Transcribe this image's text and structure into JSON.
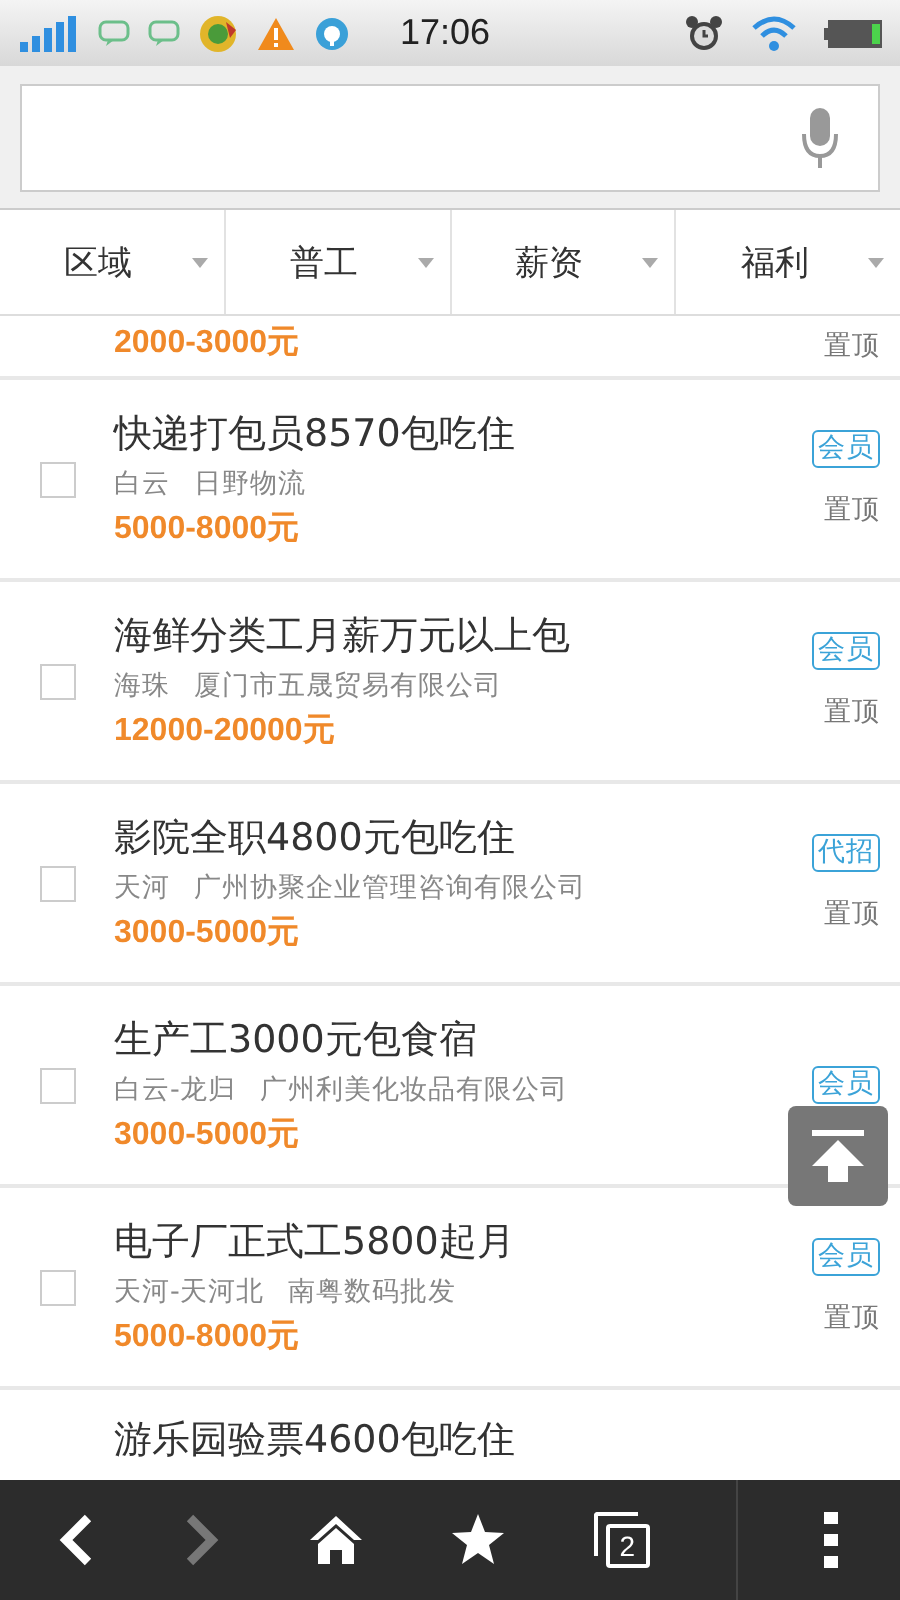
{
  "status_bar": {
    "time": "17:06"
  },
  "filters": [
    {
      "label": "区域"
    },
    {
      "label": "普工"
    },
    {
      "label": "薪资"
    },
    {
      "label": "福利"
    }
  ],
  "jobs": [
    {
      "salary": "2000-3000元",
      "pin": "置顶"
    },
    {
      "title": "快递打包员8570包吃住",
      "area": "白云",
      "company": "日野物流",
      "salary": "5000-8000元",
      "badge": "会员",
      "pin": "置顶",
      "checked": false
    },
    {
      "title": "海鲜分类工月薪万元以上包",
      "area": "海珠",
      "company": "厦门市五晟贸易有限公司",
      "salary": "12000-20000元",
      "badge": "会员",
      "pin": "置顶",
      "checked": false
    },
    {
      "title": "影院全职4800元包吃住",
      "area": "天河",
      "company": "广州协聚企业管理咨询有限公司",
      "salary": "3000-5000元",
      "badge": "代招",
      "pin": "置顶",
      "checked": false
    },
    {
      "title": "生产工3000元包食宿",
      "area": "白云-龙归",
      "company": "广州利美化妆品有限公司",
      "salary": "3000-5000元",
      "badge": "会员",
      "checked": false
    },
    {
      "title": "电子厂正式工5800起月",
      "area": "天河-天河北",
      "company": "南粤数码批发",
      "salary": "5000-8000元",
      "badge": "会员",
      "pin": "置顶",
      "checked": false
    },
    {
      "title": "游乐园验票4600包吃住"
    }
  ],
  "nav": {
    "back_disabled": false,
    "forward_disabled": true,
    "tab_count": "2"
  }
}
